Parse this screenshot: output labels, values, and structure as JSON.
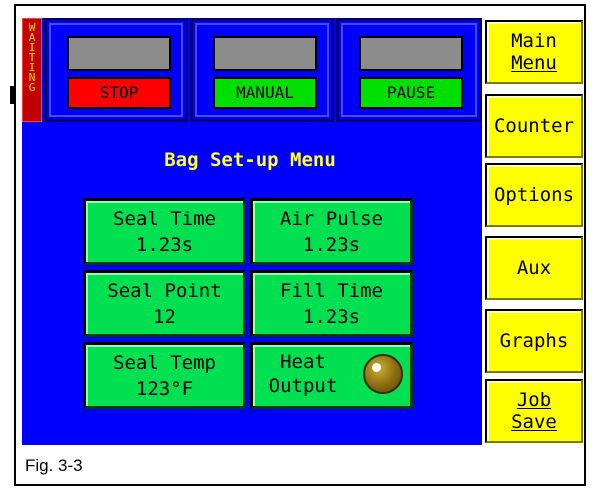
{
  "status": {
    "text": "WAITING",
    "letters": [
      "W",
      "A",
      "I",
      "T",
      "I",
      "N",
      "G"
    ]
  },
  "controls": [
    {
      "label": "STOP",
      "color": "#ff0000"
    },
    {
      "label": "MANUAL",
      "color": "#00e000"
    },
    {
      "label": "PAUSE",
      "color": "#00e000"
    }
  ],
  "menu": {
    "title": "Bag Set-up Menu",
    "items": [
      {
        "line1": "Seal Time",
        "line2": "1.23s"
      },
      {
        "line1": "Air Pulse",
        "line2": "1.23s"
      },
      {
        "line1": "Seal Point",
        "line2": "12"
      },
      {
        "line1": "Fill Time",
        "line2": "1.23s"
      },
      {
        "line1": "Seal Temp",
        "line2": "123°F"
      },
      {
        "line1": "Heat",
        "line2": "Output"
      }
    ]
  },
  "nav": [
    {
      "line1": "Main",
      "line2": "Menu"
    },
    {
      "line1": "Counter",
      "line2": ""
    },
    {
      "line1": "Options",
      "line2": ""
    },
    {
      "line1": "Aux",
      "line2": ""
    },
    {
      "line1": "Graphs",
      "line2": ""
    },
    {
      "line1": "Job",
      "line2": "Save"
    }
  ],
  "caption": "Fig. 3-3",
  "colors": {
    "screen_bg": "#0000ff",
    "menu_button": "#00e050",
    "nav_button": "#ffff00",
    "title_text": "#ffff33",
    "status_bg": "#c00000",
    "status_text": "#ffd800",
    "heat_lamp": "#8a6a0e"
  }
}
